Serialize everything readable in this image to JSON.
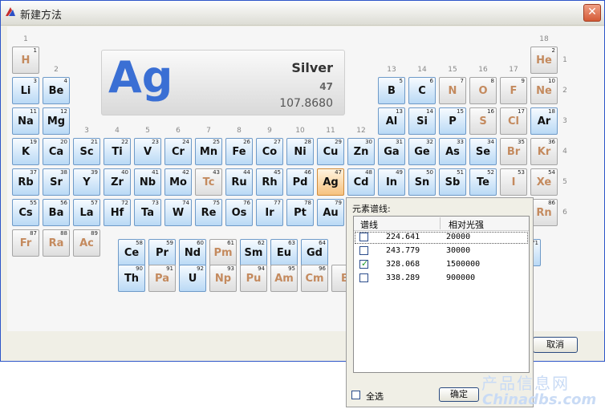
{
  "window": {
    "title": "新建方法",
    "close_symbol": "✕"
  },
  "group_numbers": [
    "1",
    "2",
    "13",
    "14",
    "15",
    "16",
    "17",
    "18"
  ],
  "period_numbers": [
    "1",
    "2",
    "3",
    "4",
    "5",
    "6"
  ],
  "sub_group_numbers": [
    "3",
    "4",
    "5",
    "6",
    "7",
    "8",
    "9",
    "10",
    "11",
    "12"
  ],
  "selected_element": {
    "symbol": "Ag",
    "name": "Silver",
    "number": "47",
    "mass": "107.8680"
  },
  "elements": [
    {
      "s": "H",
      "n": "1",
      "st": "gray"
    },
    {
      "s": "He",
      "n": "2",
      "st": "gray"
    },
    {
      "s": "Li",
      "n": "3",
      "st": "blue"
    },
    {
      "s": "Be",
      "n": "4",
      "st": "blue"
    },
    {
      "s": "B",
      "n": "5",
      "st": "blue"
    },
    {
      "s": "C",
      "n": "6",
      "st": "blue"
    },
    {
      "s": "N",
      "n": "7",
      "st": "gray"
    },
    {
      "s": "O",
      "n": "8",
      "st": "gray"
    },
    {
      "s": "F",
      "n": "9",
      "st": "gray"
    },
    {
      "s": "Ne",
      "n": "10",
      "st": "gray"
    },
    {
      "s": "Na",
      "n": "11",
      "st": "blue"
    },
    {
      "s": "Mg",
      "n": "12",
      "st": "blue"
    },
    {
      "s": "Al",
      "n": "13",
      "st": "blue"
    },
    {
      "s": "Si",
      "n": "14",
      "st": "blue"
    },
    {
      "s": "P",
      "n": "15",
      "st": "blue"
    },
    {
      "s": "S",
      "n": "16",
      "st": "gray"
    },
    {
      "s": "Cl",
      "n": "17",
      "st": "gray"
    },
    {
      "s": "Ar",
      "n": "18",
      "st": "blue"
    },
    {
      "s": "K",
      "n": "19",
      "st": "blue"
    },
    {
      "s": "Ca",
      "n": "20",
      "st": "blue"
    },
    {
      "s": "Sc",
      "n": "21",
      "st": "blue"
    },
    {
      "s": "Ti",
      "n": "22",
      "st": "blue"
    },
    {
      "s": "V",
      "n": "23",
      "st": "blue"
    },
    {
      "s": "Cr",
      "n": "24",
      "st": "blue"
    },
    {
      "s": "Mn",
      "n": "25",
      "st": "blue"
    },
    {
      "s": "Fe",
      "n": "26",
      "st": "blue"
    },
    {
      "s": "Co",
      "n": "27",
      "st": "blue"
    },
    {
      "s": "Ni",
      "n": "28",
      "st": "blue"
    },
    {
      "s": "Cu",
      "n": "29",
      "st": "blue"
    },
    {
      "s": "Zn",
      "n": "30",
      "st": "blue"
    },
    {
      "s": "Ga",
      "n": "31",
      "st": "blue"
    },
    {
      "s": "Ge",
      "n": "32",
      "st": "blue"
    },
    {
      "s": "As",
      "n": "33",
      "st": "blue"
    },
    {
      "s": "Se",
      "n": "34",
      "st": "blue"
    },
    {
      "s": "Br",
      "n": "35",
      "st": "gray"
    },
    {
      "s": "Kr",
      "n": "36",
      "st": "gray"
    },
    {
      "s": "Rb",
      "n": "37",
      "st": "blue"
    },
    {
      "s": "Sr",
      "n": "38",
      "st": "blue"
    },
    {
      "s": "Y",
      "n": "39",
      "st": "blue"
    },
    {
      "s": "Zr",
      "n": "40",
      "st": "blue"
    },
    {
      "s": "Nb",
      "n": "41",
      "st": "blue"
    },
    {
      "s": "Mo",
      "n": "42",
      "st": "blue"
    },
    {
      "s": "Tc",
      "n": "43",
      "st": "gray"
    },
    {
      "s": "Ru",
      "n": "44",
      "st": "blue"
    },
    {
      "s": "Rh",
      "n": "45",
      "st": "blue"
    },
    {
      "s": "Pd",
      "n": "46",
      "st": "blue"
    },
    {
      "s": "Ag",
      "n": "47",
      "st": "sel"
    },
    {
      "s": "Cd",
      "n": "48",
      "st": "blue"
    },
    {
      "s": "In",
      "n": "49",
      "st": "blue"
    },
    {
      "s": "Sn",
      "n": "50",
      "st": "blue"
    },
    {
      "s": "Sb",
      "n": "51",
      "st": "blue"
    },
    {
      "s": "Te",
      "n": "52",
      "st": "blue"
    },
    {
      "s": "I",
      "n": "53",
      "st": "gray"
    },
    {
      "s": "Xe",
      "n": "54",
      "st": "gray"
    },
    {
      "s": "Cs",
      "n": "55",
      "st": "blue"
    },
    {
      "s": "Ba",
      "n": "56",
      "st": "blue"
    },
    {
      "s": "La",
      "n": "57",
      "st": "blue"
    },
    {
      "s": "Hf",
      "n": "72",
      "st": "blue"
    },
    {
      "s": "Ta",
      "n": "73",
      "st": "blue"
    },
    {
      "s": "W",
      "n": "74",
      "st": "blue"
    },
    {
      "s": "Re",
      "n": "75",
      "st": "blue"
    },
    {
      "s": "Os",
      "n": "76",
      "st": "blue"
    },
    {
      "s": "Ir",
      "n": "77",
      "st": "blue"
    },
    {
      "s": "Pt",
      "n": "78",
      "st": "blue"
    },
    {
      "s": "Au",
      "n": "79",
      "st": "blue"
    },
    {
      "s": "Rn",
      "n": "86",
      "st": "gray"
    },
    {
      "s": "Fr",
      "n": "87",
      "st": "gray"
    },
    {
      "s": "Ra",
      "n": "88",
      "st": "gray"
    },
    {
      "s": "Ac",
      "n": "89",
      "st": "gray"
    },
    {
      "s": "Ce",
      "n": "58",
      "st": "blue"
    },
    {
      "s": "Pr",
      "n": "59",
      "st": "blue"
    },
    {
      "s": "Nd",
      "n": "60",
      "st": "blue"
    },
    {
      "s": "Pm",
      "n": "61",
      "st": "gray"
    },
    {
      "s": "Sm",
      "n": "62",
      "st": "blue"
    },
    {
      "s": "Eu",
      "n": "63",
      "st": "blue"
    },
    {
      "s": "Gd",
      "n": "64",
      "st": "blue"
    },
    {
      "s": "",
      "n": "71",
      "st": "blue"
    },
    {
      "s": "Th",
      "n": "90",
      "st": "blue"
    },
    {
      "s": "Pa",
      "n": "91",
      "st": "gray"
    },
    {
      "s": "U",
      "n": "92",
      "st": "blue"
    },
    {
      "s": "Np",
      "n": "93",
      "st": "gray"
    },
    {
      "s": "Pu",
      "n": "94",
      "st": "gray"
    },
    {
      "s": "Am",
      "n": "95",
      "st": "gray"
    },
    {
      "s": "Cm",
      "n": "96",
      "st": "gray"
    },
    {
      "s": "B",
      "n": "",
      "st": "gray"
    }
  ],
  "spectral_popup": {
    "title": "元素谱线:",
    "col_line": "谱线",
    "col_intensity": "相对光强",
    "rows": [
      {
        "wavelength": "224.641",
        "intensity": "20000",
        "checked": false
      },
      {
        "wavelength": "243.779",
        "intensity": "30000",
        "checked": false
      },
      {
        "wavelength": "328.068",
        "intensity": "1500000",
        "checked": true
      },
      {
        "wavelength": "338.289",
        "intensity": "900000",
        "checked": false
      }
    ],
    "select_all": "全选",
    "ok": "确定"
  },
  "cancel_button": "取消",
  "watermark": {
    "line1": "产品信息网",
    "line2": "Chinadbs.com"
  },
  "colors": {
    "cell_blue": "#b9d9f5",
    "cell_gray": "#dedede",
    "selected": "#f6c27f",
    "symbol_blue": "#3a6fd4"
  }
}
